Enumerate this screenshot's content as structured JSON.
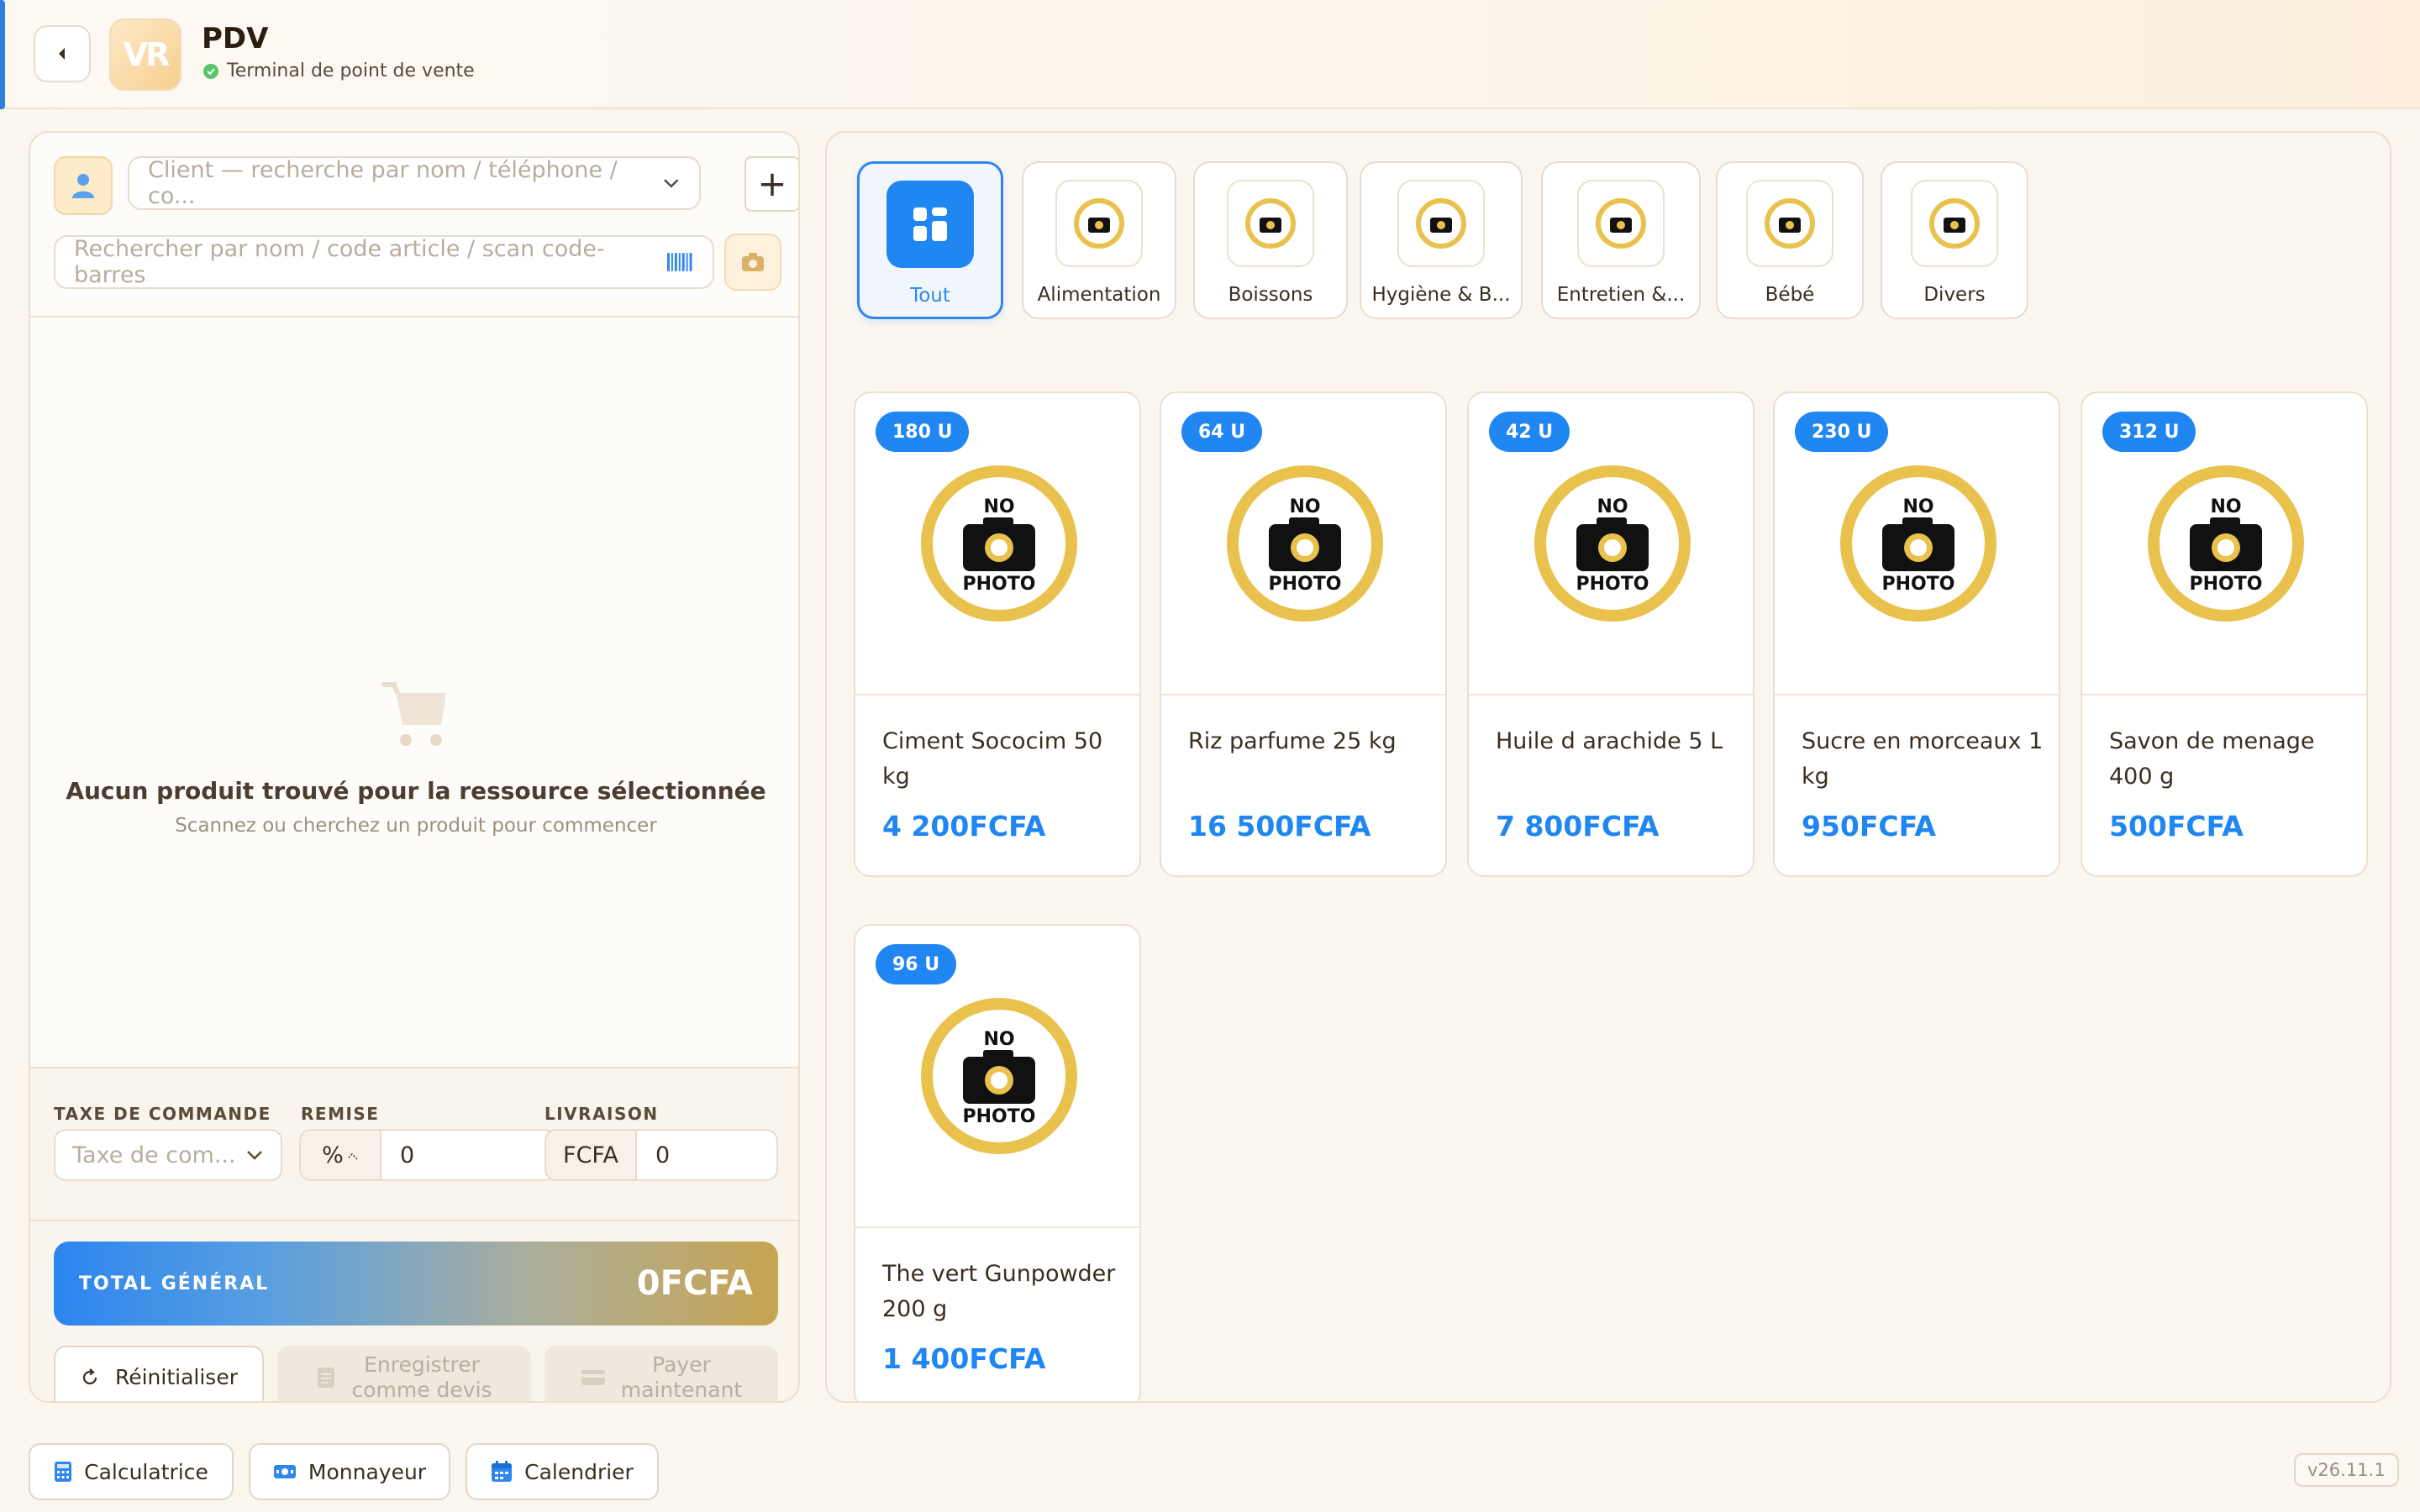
{
  "header": {
    "logo_text": "VR",
    "title": "PDV",
    "subtitle": "Terminal de point de vente"
  },
  "left_panel": {
    "client_placeholder": "Client — recherche par nom / téléphone / co...",
    "add_label": "+",
    "search_placeholder": "Rechercher par nom / code article / scan code-barres",
    "empty_message": "Aucun produit trouvé pour la ressource sélectionnée",
    "empty_hint": "Scannez ou cherchez un produit pour commencer",
    "tax_label": "TAXE DE COMMANDE",
    "tax_placeholder": "Taxe de com...",
    "discount_label": "REMISE",
    "discount_unit": "%",
    "discount_value": "0",
    "delivery_label": "LIVRAISON",
    "delivery_currency": "FCFA",
    "delivery_value": "0",
    "total_label": "TOTAL GÉNÉRAL",
    "total_value": "0FCFA",
    "reset_label": "Réinitialiser",
    "save_label_1": "Enregistrer",
    "save_label_2": "comme devis",
    "pay_label_1": "Payer",
    "pay_label_2": "maintenant"
  },
  "no_photo": {
    "line1": "NO",
    "line2": "PHOTO"
  },
  "categories": [
    {
      "label": "Tout"
    },
    {
      "label": "Alimentation"
    },
    {
      "label": "Boissons"
    },
    {
      "label": "Hygiène & B..."
    },
    {
      "label": "Entretien &..."
    },
    {
      "label": "Bébé"
    },
    {
      "label": "Divers"
    }
  ],
  "products": [
    {
      "stock": "180 U",
      "name": "Ciment Sococim 50 kg",
      "price": "4 200FCFA"
    },
    {
      "stock": "64 U",
      "name": "Riz parfume 25 kg",
      "price": "16 500FCFA"
    },
    {
      "stock": "42 U",
      "name": "Huile d arachide 5 L",
      "price": "7 800FCFA"
    },
    {
      "stock": "230 U",
      "name": "Sucre en morceaux 1 kg",
      "price": "950FCFA"
    },
    {
      "stock": "312 U",
      "name": "Savon de menage 400 g",
      "price": "500FCFA"
    },
    {
      "stock": "96 U",
      "name": "The vert Gunpowder 200 g",
      "price": "1 400FCFA"
    }
  ],
  "bottom": {
    "calculator": "Calculatrice",
    "cash": "Monnayeur",
    "calendar": "Calendrier",
    "version": "v26.11.1"
  },
  "colors": {
    "accent": "#1f86f2",
    "gold": "#e9c14d",
    "background": "#fbf6ee"
  }
}
